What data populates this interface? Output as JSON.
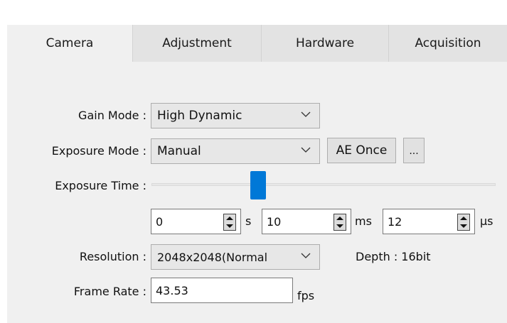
{
  "tabs": [
    {
      "label": "Camera",
      "active": true
    },
    {
      "label": "Adjustment",
      "active": false
    },
    {
      "label": "Hardware",
      "active": false
    },
    {
      "label": "Acquisition",
      "active": false
    }
  ],
  "gain_mode": {
    "label": "Gain Mode :",
    "value": "High Dynamic"
  },
  "exposure_mode": {
    "label": "Exposure Mode :",
    "value": "Manual",
    "ae_once_label": "AE Once",
    "more_label": "..."
  },
  "exposure_time": {
    "label": "Exposure Time :",
    "slider_fraction": 0.3,
    "seconds": {
      "value": "0",
      "unit": "s"
    },
    "milliseconds": {
      "value": "10",
      "unit": "ms"
    },
    "microseconds": {
      "value": "12",
      "unit": "μs"
    }
  },
  "resolution": {
    "label": "Resolution :",
    "value": "2048x2048(Normal",
    "depth_label": "Depth : 16bit"
  },
  "frame_rate": {
    "label": "Frame Rate :",
    "value": "43.53",
    "unit": "fps"
  },
  "colors": {
    "accent": "#0078d7",
    "panel": "#f0f0f0",
    "tab_inactive": "#e3e3e3"
  }
}
